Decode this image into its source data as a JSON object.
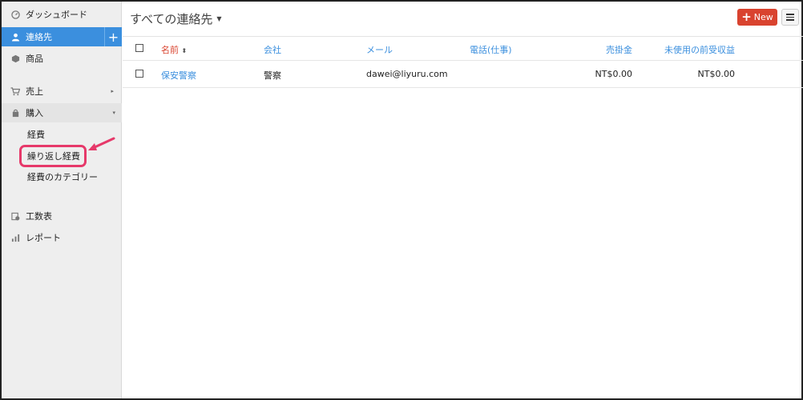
{
  "sidebar": {
    "dashboard": {
      "label": "ダッシュボード",
      "icon": "dashboard-icon"
    },
    "contacts": {
      "label": "連絡先",
      "icon": "person-icon",
      "add_label": "+"
    },
    "items": {
      "label": "商品",
      "icon": "box-icon"
    },
    "sales": {
      "label": "売上",
      "icon": "cart-icon"
    },
    "purchases": {
      "label": "購入",
      "icon": "bag-icon",
      "sub_items": [
        "経費",
        "繰り返し経費",
        "経費のカテゴリー"
      ]
    },
    "timesheet": {
      "label": "工数表",
      "icon": "timesheet-icon"
    },
    "reports": {
      "label": "レポート",
      "icon": "bar-chart-icon"
    }
  },
  "header": {
    "title": "すべての連絡先",
    "new_button": "New",
    "new_plus": "+"
  },
  "table": {
    "columns": [
      "名前",
      "会社",
      "メール",
      "電話(仕事)",
      "売掛金",
      "未使用の前受収益"
    ],
    "rows": [
      {
        "name": "保安警察",
        "company": "警察",
        "email": "dawei@liyuru.com",
        "phone": "",
        "receivables": "NT$0.00",
        "unused_credits": "NT$0.00"
      }
    ]
  },
  "colors": {
    "accent": "#3b8fde",
    "brand_red": "#d9432f",
    "highlight": "#e6396a",
    "sidebar_bg": "#eeeeee"
  }
}
